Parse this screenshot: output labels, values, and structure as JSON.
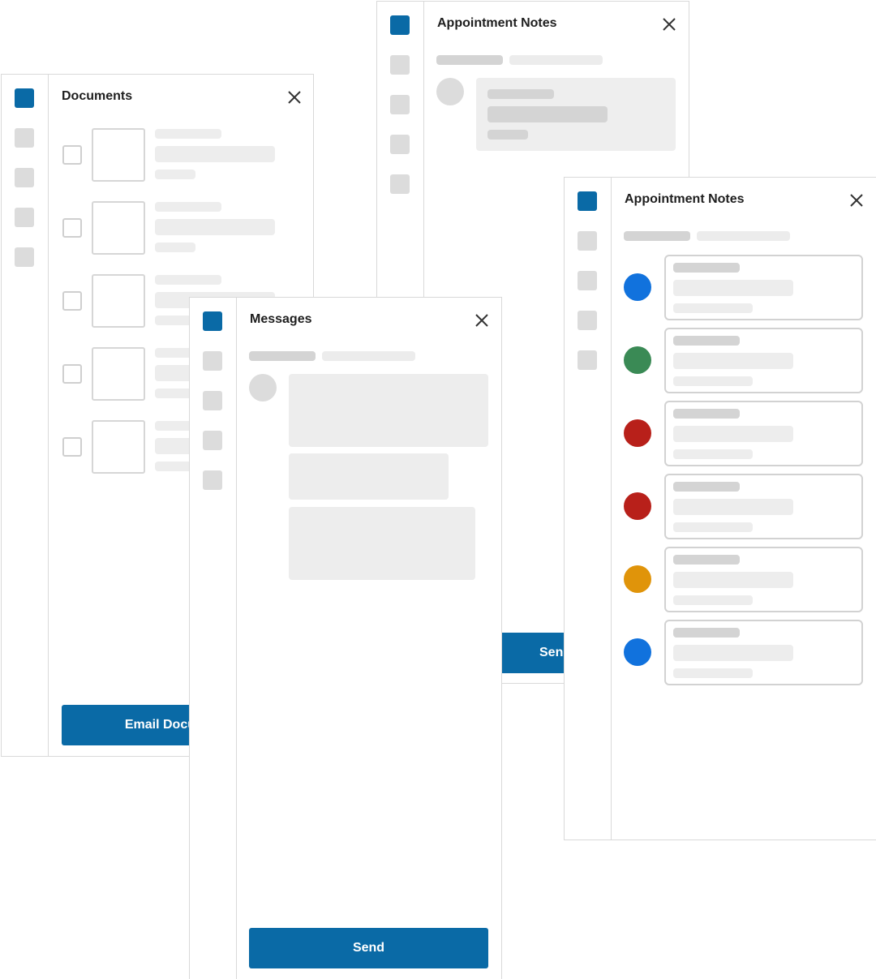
{
  "documents": {
    "title": "Documents",
    "button_label": "Email Documents",
    "item_count": 5
  },
  "appointment_notes_back": {
    "title": "Appointment Notes",
    "button_label": "Send"
  },
  "messages": {
    "title": "Messages",
    "button_label": "Send"
  },
  "appointment_notes_front": {
    "title": "Appointment Notes",
    "note_colors": [
      "#1172dd",
      "#3a8a55",
      "#b8201a",
      "#b8201a",
      "#e0940a",
      "#1172dd"
    ]
  },
  "colors": {
    "accent": "#0a6aa6",
    "border": "#d9d9d9",
    "skeleton": "#ededed"
  },
  "icons": {
    "close": "close-icon",
    "nav": "nav-square-icon"
  }
}
